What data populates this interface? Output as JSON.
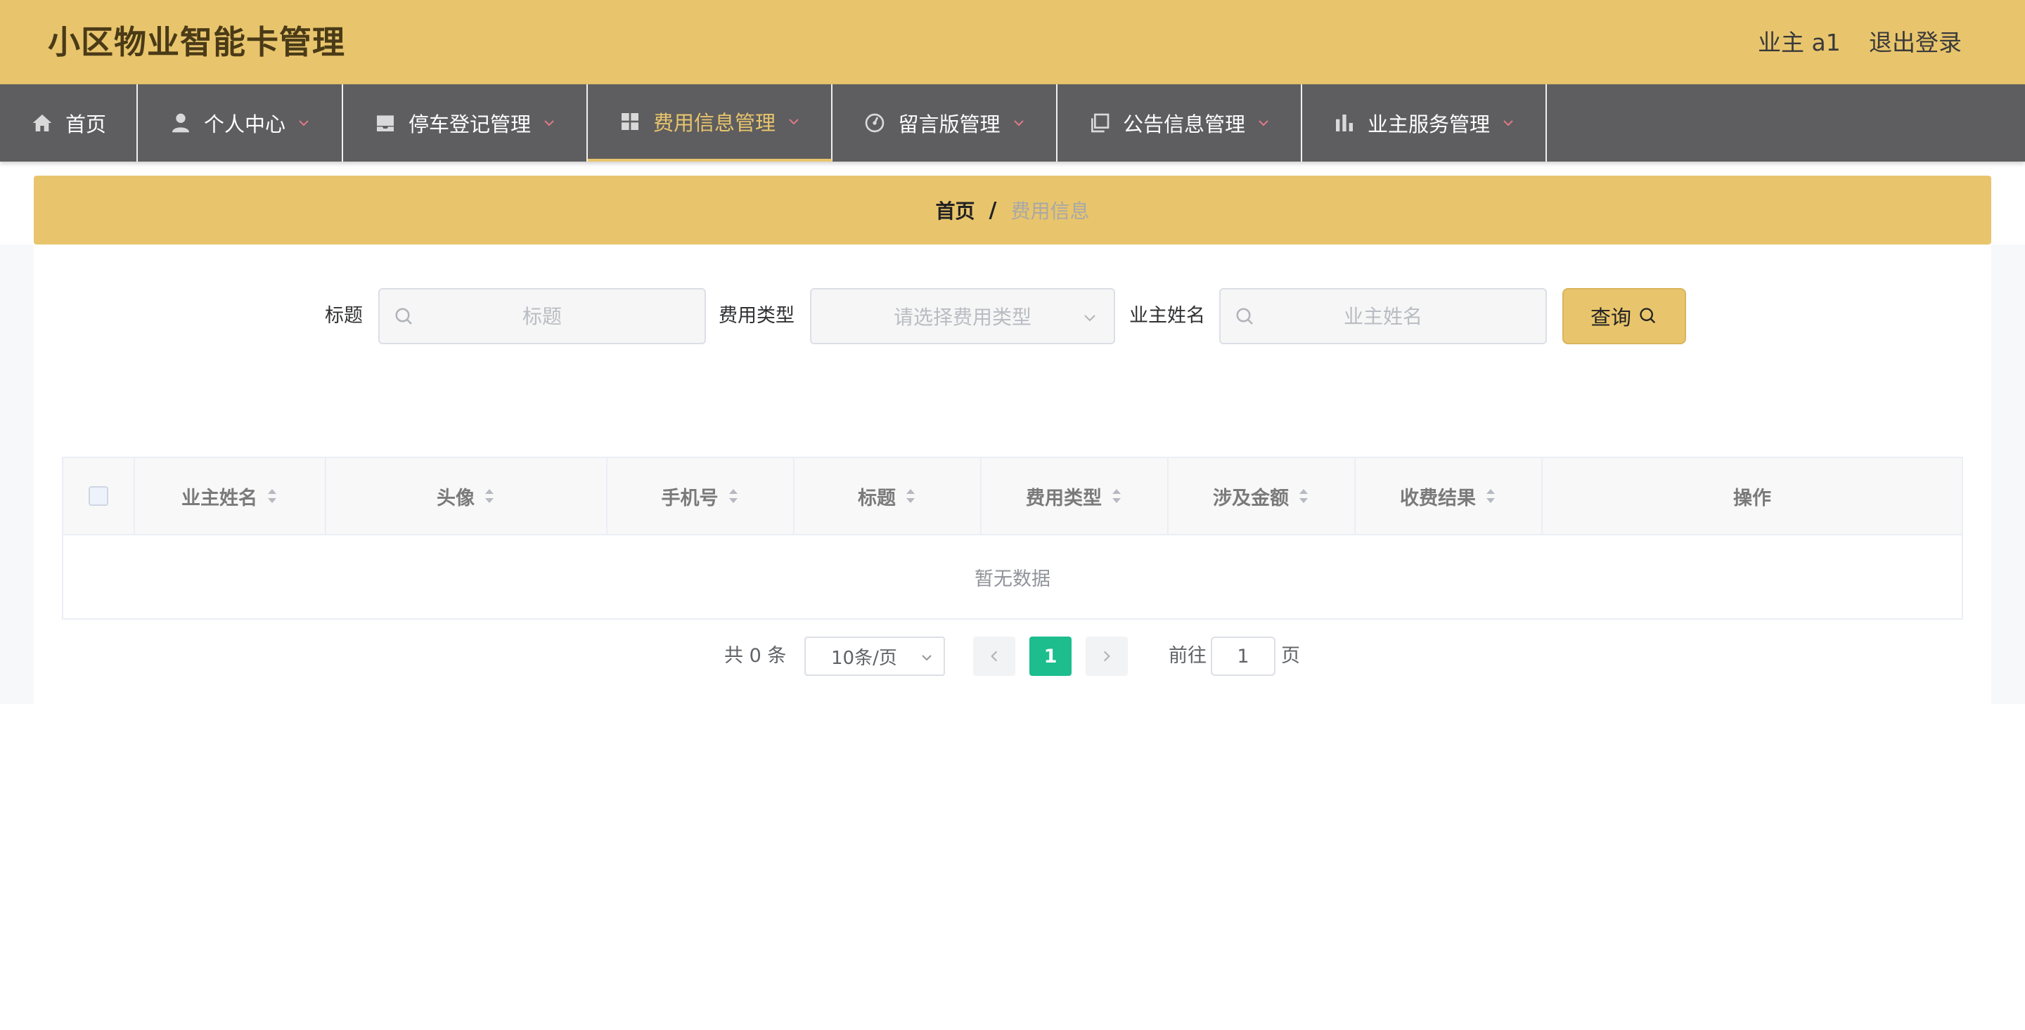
{
  "header": {
    "title": "小区物业智能卡管理",
    "user": "业主 a1",
    "logout": "退出登录"
  },
  "nav": {
    "items": [
      {
        "label": "首页",
        "icon": "home-icon"
      },
      {
        "label": "个人中心",
        "icon": "user-icon"
      },
      {
        "label": "停车登记管理",
        "icon": "inbox-icon"
      },
      {
        "label": "费用信息管理",
        "icon": "grid-icon",
        "active": true
      },
      {
        "label": "留言版管理",
        "icon": "dashboard-icon"
      },
      {
        "label": "公告信息管理",
        "icon": "copy-icon"
      },
      {
        "label": "业主服务管理",
        "icon": "bar-chart-icon"
      }
    ]
  },
  "breadcrumb": {
    "home": "首页",
    "separator": "/",
    "current": "费用信息"
  },
  "search": {
    "title_label": "标题",
    "title_placeholder": "标题",
    "type_label": "费用类型",
    "type_placeholder": "请选择费用类型",
    "owner_label": "业主姓名",
    "owner_placeholder": "业主姓名",
    "query_button": "查询"
  },
  "table": {
    "columns": [
      "业主姓名",
      "头像",
      "手机号",
      "标题",
      "费用类型",
      "涉及金额",
      "收费结果",
      "操作"
    ],
    "empty_text": "暂无数据"
  },
  "pagination": {
    "total": "共 0 条",
    "page_size": "10条/页",
    "current_page": "1",
    "goto_label": "前往",
    "goto_value": "1",
    "goto_unit": "页"
  },
  "colors": {
    "accent": "#e8c56d",
    "nav_bg": "#5e5d5f",
    "page_active": "#1dbd8e"
  }
}
